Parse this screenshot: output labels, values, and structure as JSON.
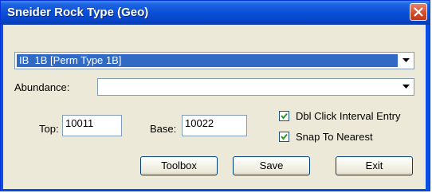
{
  "window": {
    "title": "Sneider Rock Type (Geo)"
  },
  "rock_type_select": {
    "code": "IB",
    "value": "1B [Perm Type 1B]"
  },
  "abundance": {
    "label": "Abundance:",
    "value": ""
  },
  "top": {
    "label": "Top:",
    "value": "10011"
  },
  "base": {
    "label": "Base:",
    "value": "10022"
  },
  "options": {
    "dbl_click": {
      "label": "Dbl Click Interval Entry",
      "checked": true
    },
    "snap": {
      "label": "Snap To Nearest",
      "checked": true
    }
  },
  "buttons": {
    "toolbox": "Toolbox",
    "save": "Save",
    "exit": "Exit"
  },
  "colors": {
    "title_bar": "#0a4fd9",
    "selection": "#316ac5",
    "face": "#ece9d8",
    "close": "#d54a28"
  }
}
